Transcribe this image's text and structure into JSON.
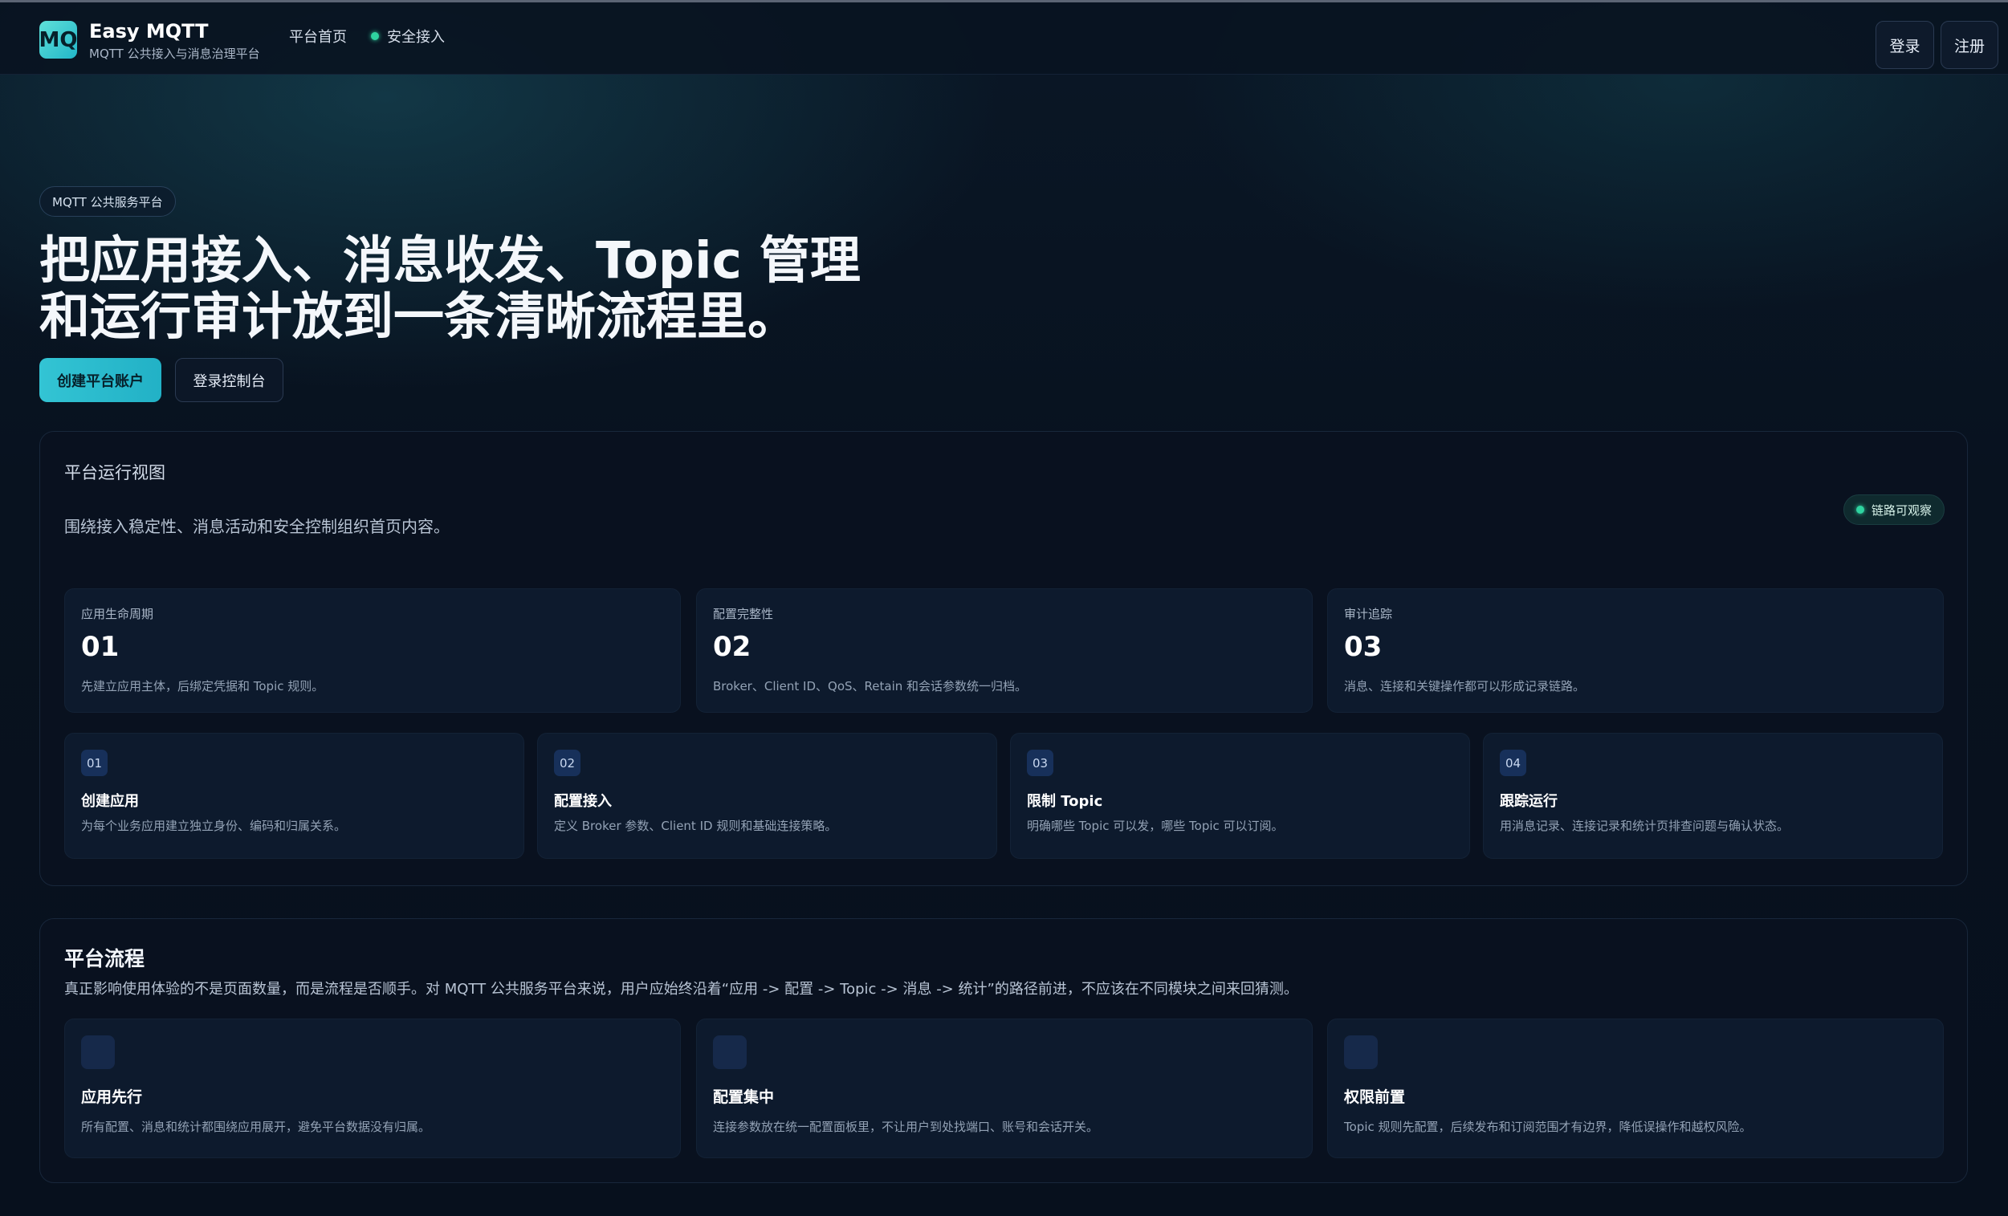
{
  "header": {
    "logo_text": "MQ",
    "brand_name": "Easy MQTT",
    "brand_subtitle": "MQTT 公共接入与消息治理平台",
    "nav": {
      "home": "平台首页",
      "secure_access": "安全接入"
    },
    "login_label": "登录",
    "register_label": "注册"
  },
  "hero": {
    "badge": "MQTT 公共服务平台",
    "title_line1": "把应用接入、消息收发、Topic 管理",
    "title_line2": "和运行审计放到一条清晰流程里。",
    "primary_cta": "创建平台账户",
    "secondary_cta": "登录控制台"
  },
  "overview": {
    "title": "平台运行视图",
    "description": "围绕接入稳定性、消息活动和安全控制组织首页内容。",
    "badge": "链路可观察",
    "stats": [
      {
        "label": "应用生命周期",
        "number": "01",
        "desc": "先建立应用主体，后绑定凭据和 Topic 规则。"
      },
      {
        "label": "配置完整性",
        "number": "02",
        "desc": "Broker、Client ID、QoS、Retain 和会话参数统一归档。"
      },
      {
        "label": "审计追踪",
        "number": "03",
        "desc": "消息、连接和关键操作都可以形成记录链路。"
      }
    ],
    "steps": [
      {
        "index": "01",
        "title": "创建应用",
        "desc": "为每个业务应用建立独立身份、编码和归属关系。"
      },
      {
        "index": "02",
        "title": "配置接入",
        "desc": "定义 Broker 参数、Client ID 规则和基础连接策略。"
      },
      {
        "index": "03",
        "title": "限制 Topic",
        "desc": "明确哪些 Topic 可以发，哪些 Topic 可以订阅。"
      },
      {
        "index": "04",
        "title": "跟踪运行",
        "desc": "用消息记录、连接记录和统计页排查问题与确认状态。"
      }
    ]
  },
  "flow": {
    "title": "平台流程",
    "description": "真正影响使用体验的不是页面数量，而是流程是否顺手。对 MQTT 公共服务平台来说，用户应始终沿着“应用 -> 配置 -> Topic -> 消息 -> 统计”的路径前进，不应该在不同模块之间来回猜测。",
    "cards": [
      {
        "title": "应用先行",
        "desc": "所有配置、消息和统计都围绕应用展开，避免平台数据没有归属。"
      },
      {
        "title": "配置集中",
        "desc": "连接参数放在统一配置面板里，不让用户到处找端口、账号和会话开关。"
      },
      {
        "title": "权限前置",
        "desc": "Topic 规则先配置，后续发布和订阅范围才有边界，降低误操作和越权风险。"
      }
    ]
  },
  "colors": {
    "accent": "#33c4d4",
    "status_green": "#2fd3a0",
    "background": "#07101d"
  }
}
